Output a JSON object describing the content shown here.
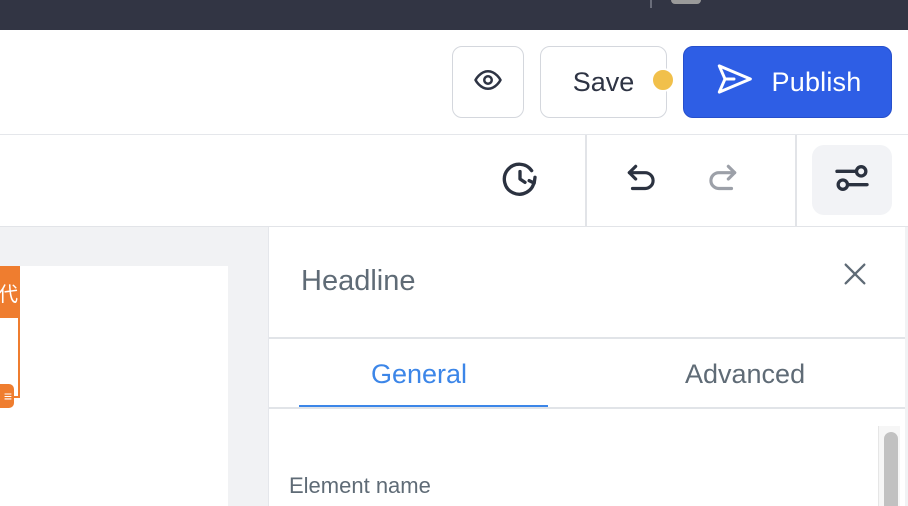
{
  "header": {
    "preview_icon": "eye-icon",
    "save_label": "Save",
    "save_unsaved_indicator_color": "#f1c04b",
    "publish_label": "Publish",
    "publish_icon": "send-icon",
    "publish_color": "#2e5ee5"
  },
  "toolbar": {
    "history_icon": "history-icon",
    "undo_icon": "undo-icon",
    "redo_icon": "redo-icon",
    "settings_icon": "sliders-icon"
  },
  "canvas": {
    "selection_color": "#ef7d2f",
    "selection_tag_top_glyph": "代",
    "selection_tag_bottom_glyph": "≡"
  },
  "panel": {
    "title": "Headline",
    "close_icon": "close-icon",
    "tabs": [
      {
        "label": "General",
        "active": true
      },
      {
        "label": "Advanced",
        "active": false
      }
    ],
    "active_tab_color": "#3c86e8",
    "fields": [
      {
        "label": "Element name"
      }
    ]
  }
}
